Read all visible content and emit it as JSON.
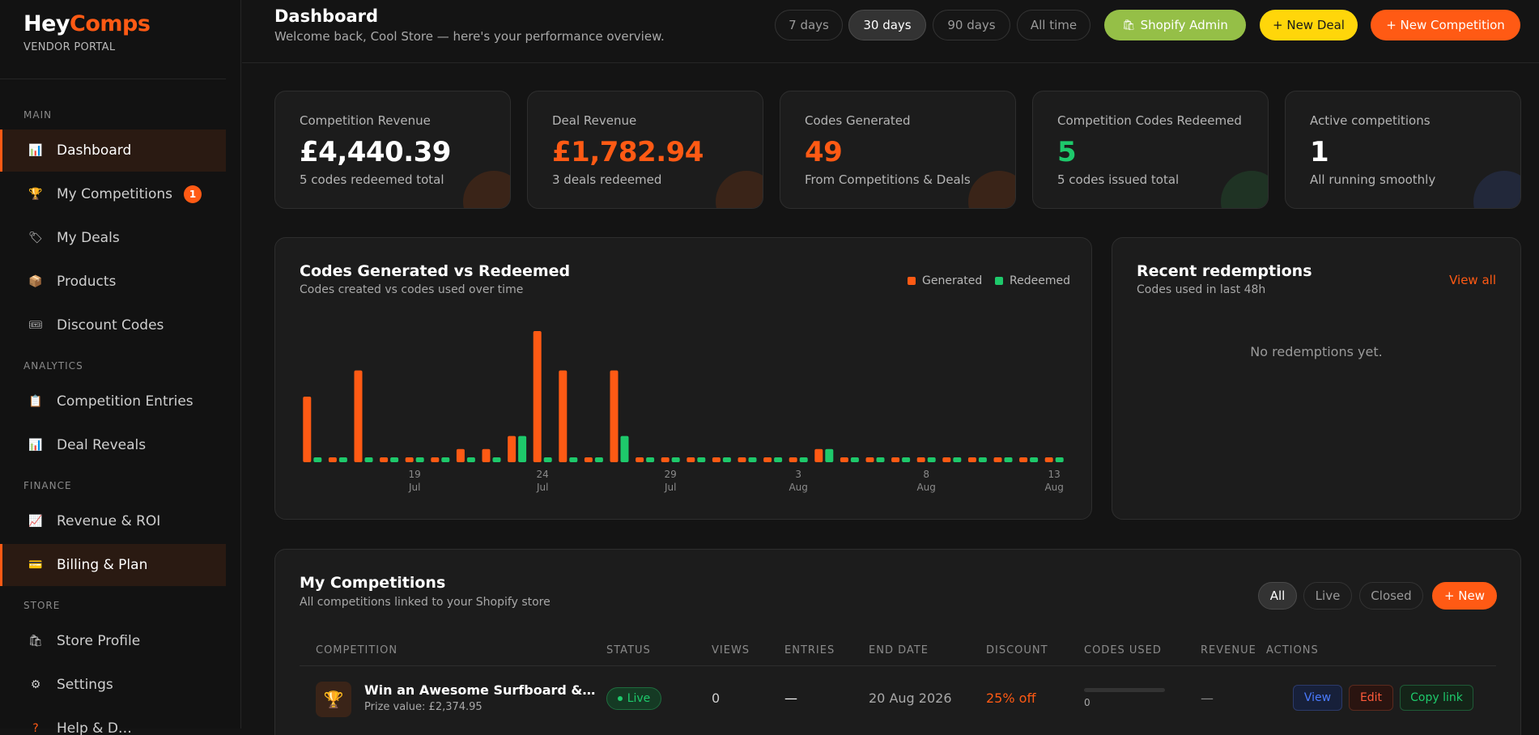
{
  "brand": {
    "name_a": "Hey",
    "name_b": "Comps",
    "subtitle": "VENDOR PORTAL"
  },
  "sidebar": {
    "sections": {
      "main": "MAIN",
      "analytics": "ANALYTICS",
      "finance": "FINANCE",
      "store": "STORE"
    },
    "items": [
      {
        "label": "Dashboard",
        "icon": "bar-chart-icon",
        "glyph": "📊"
      },
      {
        "label": "My Competitions",
        "icon": "trophy-icon",
        "glyph": "🏆",
        "badge": "1"
      },
      {
        "label": "My Deals",
        "icon": "tag-icon",
        "glyph": "🏷"
      },
      {
        "label": "Products",
        "icon": "package-icon",
        "glyph": "📦"
      },
      {
        "label": "Discount Codes",
        "icon": "ticket-icon",
        "glyph": "🎟"
      },
      {
        "label": "Competition Entries",
        "icon": "clipboard-icon",
        "glyph": "📋"
      },
      {
        "label": "Deal Reveals",
        "icon": "bar-chart-icon",
        "glyph": "📊"
      },
      {
        "label": "Revenue & ROI",
        "icon": "trend-chart-icon",
        "glyph": "📈"
      },
      {
        "label": "Billing & Plan",
        "icon": "credit-card-icon",
        "glyph": "💳"
      },
      {
        "label": "Store Profile",
        "icon": "store-icon",
        "glyph": "🛍"
      },
      {
        "label": "Settings",
        "icon": "gear-icon",
        "glyph": "⚙"
      },
      {
        "label": "Help & D…",
        "icon": "help-icon",
        "glyph": "?"
      }
    ]
  },
  "header": {
    "title": "Dashboard",
    "subtitle": "Welcome back, Cool Store — here's your performance overview.",
    "ranges": [
      "7 days",
      "30 days",
      "90 days",
      "All time"
    ],
    "active_range": "30 days",
    "shopify_label": "Shopify Admin",
    "new_deal_label": "+ New Deal",
    "new_competition_label": "+ New Competition"
  },
  "stats": [
    {
      "label": "Competition Revenue",
      "value": "£4,440.39",
      "sub": "5 codes redeemed total",
      "color": "#ffffff"
    },
    {
      "label": "Deal Revenue",
      "value": "£1,782.94",
      "sub": "3 deals redeemed",
      "color": "#ff5a14"
    },
    {
      "label": "Codes Generated",
      "value": "49",
      "sub": "From Competitions & Deals",
      "color": "#ff5a14"
    },
    {
      "label": "Competition Codes Redeemed",
      "value": "5",
      "sub": "5 codes issued total",
      "color": "#1ec96b"
    },
    {
      "label": "Active competitions",
      "value": "1",
      "sub": "All running smoothly",
      "color": "#ffffff"
    }
  ],
  "chart_panel": {
    "title": "Codes Generated vs Redeemed",
    "subtitle": "Codes created vs codes used over time",
    "legend_generated": "Generated",
    "legend_redeemed": "Redeemed"
  },
  "chart_data": {
    "type": "bar",
    "x_ticks": [
      {
        "day": "19",
        "month": "Jul",
        "index": 4
      },
      {
        "day": "24",
        "month": "Jul",
        "index": 9
      },
      {
        "day": "29",
        "month": "Jul",
        "index": 14
      },
      {
        "day": "3",
        "month": "Aug",
        "index": 19
      },
      {
        "day": "8",
        "month": "Aug",
        "index": 24
      },
      {
        "day": "13",
        "month": "Aug",
        "index": 29
      }
    ],
    "series": [
      {
        "name": "Generated",
        "color": "#ff5a14",
        "values": [
          5,
          0,
          7,
          0,
          0,
          0,
          1,
          1,
          2,
          10,
          7,
          0,
          7,
          0,
          0,
          0,
          0,
          0,
          0,
          0,
          1,
          0,
          0,
          0,
          0,
          0,
          0,
          0,
          0,
          0
        ]
      },
      {
        "name": "Redeemed",
        "color": "#1ec96b",
        "values": [
          0,
          0,
          0,
          0,
          0,
          0,
          0,
          0,
          2,
          0,
          0,
          0,
          2,
          0,
          0,
          0,
          0,
          0,
          0,
          0,
          1,
          0,
          0,
          0,
          0,
          0,
          0,
          0,
          0,
          0
        ]
      }
    ],
    "ylim": [
      0,
      10
    ]
  },
  "recent": {
    "title": "Recent redemptions",
    "subtitle": "Codes used in last 48h",
    "view_all": "View all",
    "empty": "No redemptions yet."
  },
  "competitions": {
    "title": "My Competitions",
    "subtitle": "All competitions linked to your Shopify store",
    "filters": [
      "All",
      "Live",
      "Closed"
    ],
    "new_label": "+ New",
    "columns": [
      "COMPETITION",
      "STATUS",
      "VIEWS",
      "ENTRIES",
      "END DATE",
      "DISCOUNT",
      "CODES USED",
      "REVENUE",
      "ACTIONS"
    ],
    "rows": [
      {
        "name": "Win an Awesome Surfboard &…",
        "prize": "Prize value: £2,374.95",
        "status": "Live",
        "views": "0",
        "entries": "—",
        "end_date": "20 Aug 2026",
        "discount": "25% off",
        "codes_used": "0",
        "codes_used_fraction": 0,
        "revenue": "—",
        "actions": [
          "View",
          "Edit",
          "Copy link"
        ]
      }
    ]
  }
}
